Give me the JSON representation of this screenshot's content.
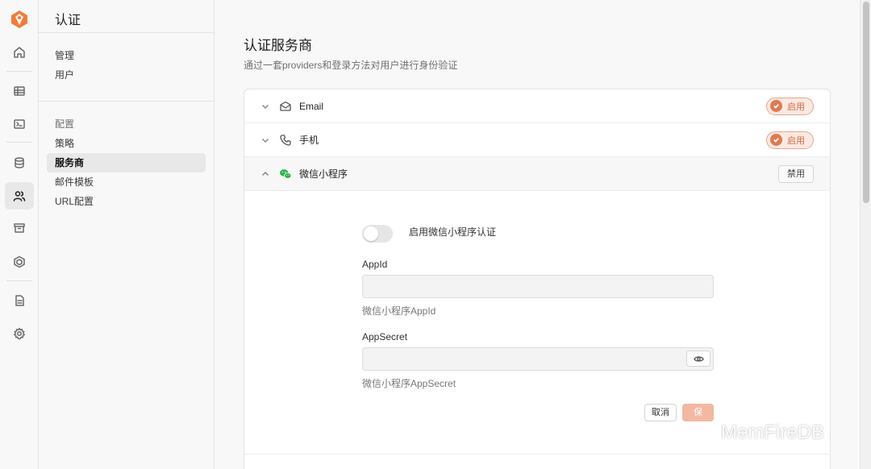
{
  "menu": {
    "title": "认证",
    "group1": [
      "管理",
      "用户"
    ],
    "group2_title": "配置",
    "group2": [
      "策略",
      "服务商",
      "邮件模板",
      "URL配置"
    ]
  },
  "main": {
    "title": "认证服务商",
    "subtitle": "通过一套providers和登录方法对用户进行身份验证"
  },
  "providers": [
    {
      "name": "Email",
      "status": "启用"
    },
    {
      "name": "手机",
      "status": "启用"
    },
    {
      "name": "微信小程序",
      "status": "禁用"
    }
  ],
  "form": {
    "toggle_label": "启用微信小程序认证",
    "appid_label": "AppId",
    "appid_value": "",
    "appid_help": "微信小程序AppId",
    "secret_label": "AppSecret",
    "secret_value": "",
    "secret_help": "微信小程序AppSecret",
    "cancel_label": "取消",
    "save_label": "保存"
  },
  "watermark": "MemFireDB",
  "colors": {
    "accent": "#de7a52",
    "wechat": "#2bb24c"
  },
  "icons": [
    "logo-icon",
    "home-icon",
    "table-icon",
    "terminal-icon",
    "database-icon",
    "users-icon",
    "archive-icon",
    "hexagon-icon",
    "document-icon",
    "gear-icon",
    "mail-icon",
    "phone-icon",
    "wechat-icon",
    "eye-icon",
    "chevron-down-icon",
    "chevron-up-icon",
    "check-icon"
  ]
}
